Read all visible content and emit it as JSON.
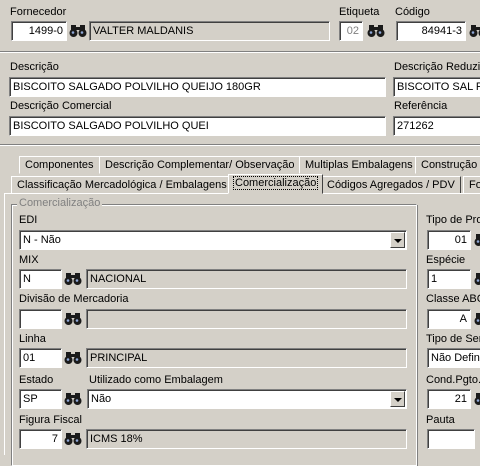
{
  "header": {
    "fornecedor_label": "Fornecedor",
    "fornecedor_code": "1499-0",
    "fornecedor_name": "VALTER MALDANIS",
    "etiqueta_label": "Etiqueta",
    "etiqueta_value": "02",
    "codigo_label": "Código",
    "codigo_value": "84941-3",
    "descricao_label": "Descrição",
    "descricao_value": "BISCOITO SALGADO POLVILHO QUEIJO 180GR",
    "descricao_reduzida_label": "Descrição Reduzida",
    "descricao_reduzida_value": "BISCOITO SAL PO",
    "descricao_comercial_label": "Descrição Comercial",
    "descricao_comercial_value": "BISCOITO SALGADO POLVILHO QUEI",
    "referencia_label": "Referência",
    "referencia_value": "271262"
  },
  "tabs_row1": [
    "Componentes",
    "Descrição Complementar/ Observação",
    "Multiplas Embalagens",
    "Construção"
  ],
  "tabs_row2": [
    "Classificação Mercadológica / Embalagens",
    "Comercialização",
    "Códigos Agregados / PDV",
    "Fo"
  ],
  "group": {
    "title": "Comercialização",
    "edi_label": "EDI",
    "edi_value": "N - Não",
    "mix_label": "MIX",
    "mix_code": "N",
    "mix_desc": "NACIONAL",
    "divisao_label": "Divisão de Mercadoria",
    "divisao_code": "",
    "divisao_desc": "",
    "linha_label": "Linha",
    "linha_code": "01",
    "linha_desc": "PRINCIPAL",
    "estado_label": "Estado",
    "estado_code": "SP",
    "embalagem_label": "Utilizado como Embalagem",
    "embalagem_value": "Não",
    "figura_label": "Figura Fiscal",
    "figura_code": "7",
    "figura_desc": "ICMS 18%"
  },
  "right_column": {
    "tipo_prod_label": "Tipo de Pro",
    "tipo_prod_value": "01",
    "especie_label": "Espécie",
    "especie_value": "1",
    "classe_abc_label": "Classe ABC",
    "classe_abc_value": "A",
    "tipo_serv_label": "Tipo de Ser",
    "tipo_serv_value": "Não Defini",
    "cond_pgto_label": "Cond.Pgto.",
    "cond_pgto_value": "21",
    "pauta_label": "Pauta",
    "pauta_value": ""
  },
  "icons": {
    "search": "binoculars-icon",
    "dropdown": "chevron-down-icon"
  }
}
